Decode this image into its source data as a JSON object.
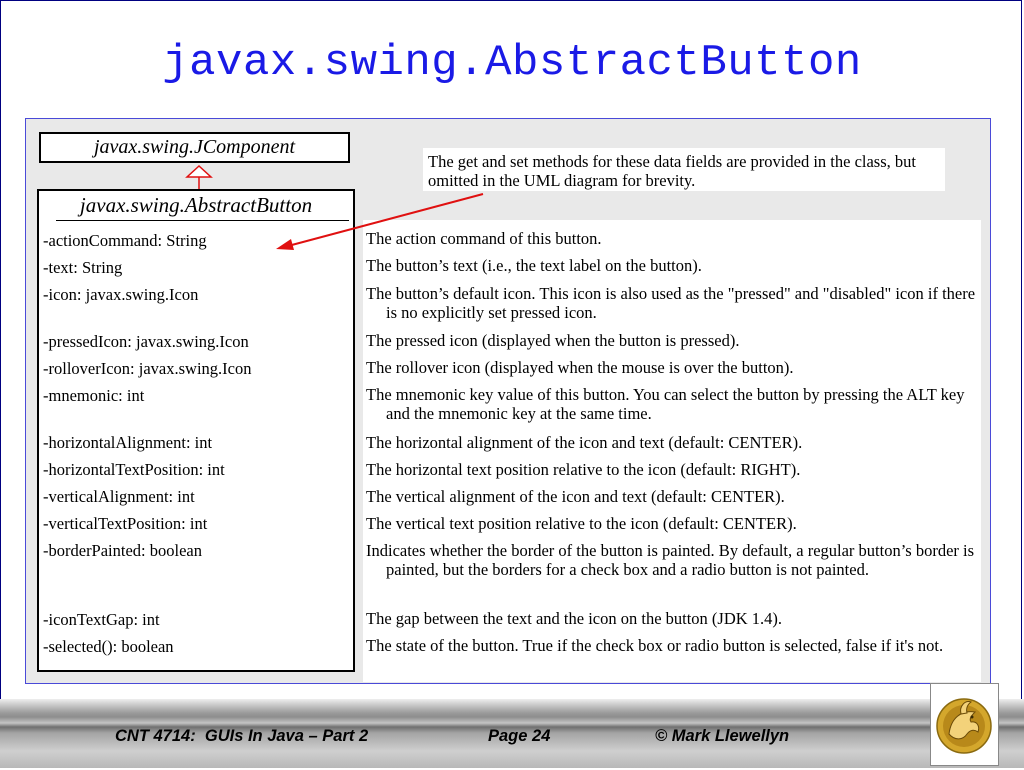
{
  "slide": {
    "title": "javax.swing.AbstractButton"
  },
  "uml": {
    "parent_class": "javax.swing.JComponent",
    "class_name": "javax.swing.AbstractButton",
    "note": "The get and set methods for these data fields are provided in the class, but omitted in the UML diagram for brevity.",
    "fields": [
      "-actionCommand: String",
      "-text: String",
      "-icon: javax.swing.Icon",
      "-pressedIcon: javax.swing.Icon",
      "-rolloverIcon: javax.swing.Icon",
      "-mnemonic: int",
      "-horizontalAlignment: int",
      "-horizontalTextPosition: int",
      "-verticalAlignment: int",
      "-verticalTextPosition: int",
      "-borderPainted: boolean",
      "-iconTextGap: int",
      "-selected(): boolean"
    ],
    "descriptions": [
      "The action command of this button.",
      "The button’s text (i.e., the text label on the button).",
      "The button’s default icon. This icon is also used as the \"pressed\" and \"disabled\" icon if there is no explicitly set pressed icon.",
      "The pressed icon (displayed when the button is pressed).",
      "The rollover icon (displayed when the mouse is over the button).",
      "The mnemonic key value of this button. You can select the button by pressing the ALT key and the mnemonic key at the same time.",
      "The horizontal alignment of the icon and text (default: CENTER).",
      "The horizontal text position relative to the icon (default: RIGHT).",
      "The vertical alignment of the icon and text (default: CENTER).",
      "The vertical text position relative to the icon (default: CENTER).",
      "Indicates whether the border of the button is painted. By default, a regular button’s border is painted, but the borders for a check box and a radio button is not painted.",
      "The gap between the text and the icon on the button (JDK 1.4).",
      "The state of the button. True if the check box or radio button is selected, false if it's not."
    ]
  },
  "footer": {
    "course": "CNT 4714:  GUIs In Java – Part 2",
    "page": "Page 24",
    "copyright": "© Mark Llewellyn"
  },
  "colors": {
    "title": "#1a1ae6",
    "arrow": "#e01010",
    "panel_border": "#4a4ad8"
  },
  "icons": {
    "logo": "pegasus-logo-icon"
  }
}
